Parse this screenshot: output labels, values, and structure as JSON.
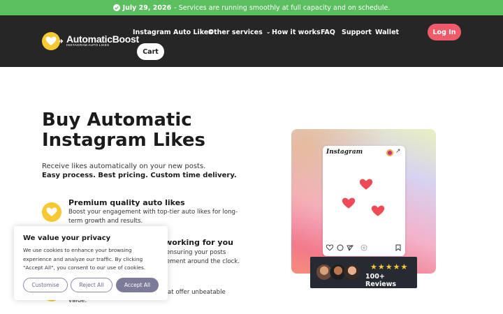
{
  "banner": {
    "date": "July 29, 2026",
    "message": " - Services are running smoothly at full capacity and on schedule."
  },
  "brand": {
    "name": "AutomaticBoost",
    "tagline": "INSTAGRAM AUTO LIKES",
    "icon": "heart-icon"
  },
  "nav": {
    "items": [
      "Instagram Auto Likes",
      "Other services",
      "How it works",
      "FAQ",
      "Support",
      "Wallet"
    ],
    "login": "Log In",
    "cart": "Cart"
  },
  "hero": {
    "title": "Buy Automatic Instagram Likes",
    "subtitle": "Receive likes automatically on your new posts.",
    "subtitle_bold": "Easy process. Best pricing. Custom time delivery."
  },
  "features": [
    {
      "title": "Premium quality auto likes",
      "desc_line1": "Boost your engagement with top-tier auto likes for long-",
      "desc_line2": "term growth and results."
    },
    {
      "title": "s working for you",
      "desc_line1": "ensuring your posts",
      "desc_line2": "ement around the clock."
    },
    {
      "desc_line1": "at offer unbeatable",
      "desc_line2": "value."
    }
  ],
  "promo": {
    "app_name": "Instagram",
    "rating_stars": "★★★★★",
    "reviews": "100+ Reviews"
  },
  "cookie": {
    "title": "We value your privacy",
    "text": "We use cookies to enhance your browsing experience and analyze our traffic. By clicking \"Accept All\", you consent to our use of cookies.",
    "customise": "Customise",
    "reject": "Reject All",
    "accept": "Accept All"
  },
  "colors": {
    "accent_green": "#5cbf5f",
    "nav_bg": "#262626",
    "brand_yellow": "#f7c832",
    "login_red": "#ef5b6a",
    "heart_red": "#ef4b57",
    "cookie_button": "#7c7b99"
  }
}
